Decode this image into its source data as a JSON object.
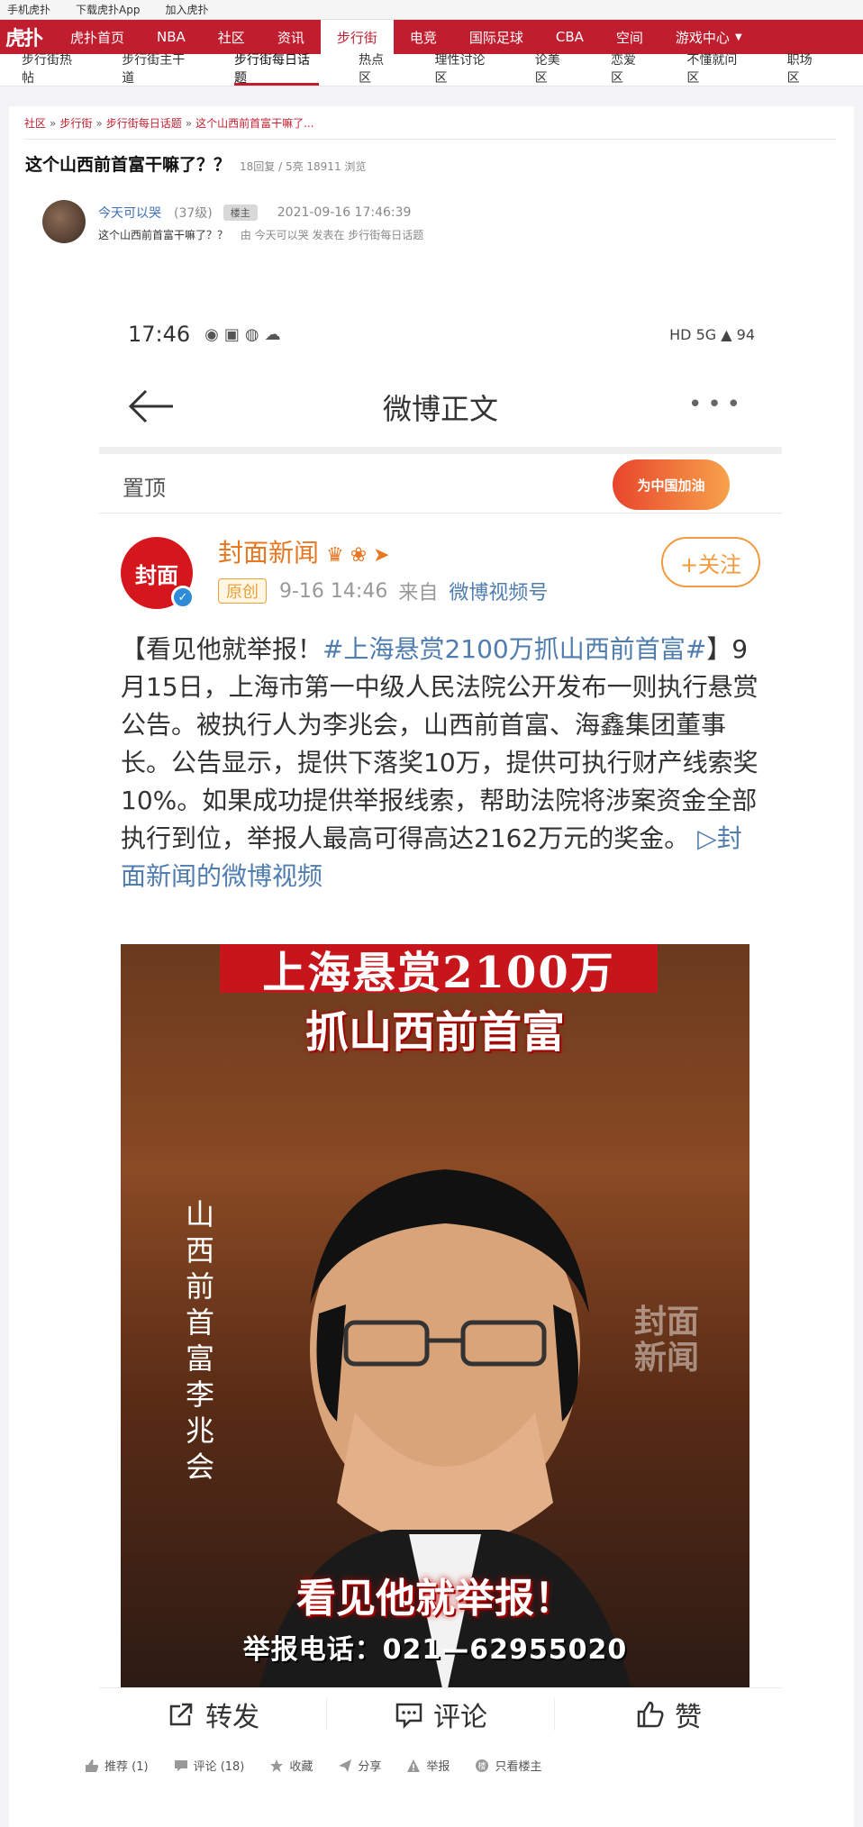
{
  "util_bar": {
    "items": [
      "手机虎扑",
      "下载虎扑App",
      "加入虎扑"
    ]
  },
  "brand": {
    "logo_text": "虎扑",
    "color": "#c01e2f"
  },
  "main_nav": {
    "items": [
      {
        "label": "虎扑首页"
      },
      {
        "label": "NBA"
      },
      {
        "label": "社区"
      },
      {
        "label": "资讯"
      },
      {
        "label": "步行街",
        "active": true
      },
      {
        "label": "电竞"
      },
      {
        "label": "国际足球"
      },
      {
        "label": "CBA"
      },
      {
        "label": "空间"
      },
      {
        "label": "游戏中心",
        "dropdown": true
      }
    ]
  },
  "sub_nav": {
    "items": [
      {
        "label": "步行街热帖"
      },
      {
        "label": "步行街主干道"
      },
      {
        "label": "步行街每日话题",
        "active": true
      },
      {
        "label": "热点区"
      },
      {
        "label": "理性讨论区"
      },
      {
        "label": "论美区"
      },
      {
        "label": "恋爱区"
      },
      {
        "label": "不懂就问区"
      },
      {
        "label": "职场区"
      }
    ]
  },
  "breadcrumb": [
    "社区",
    "步行街",
    "步行街每日话题",
    "这个山西前首富干嘛了..."
  ],
  "thread": {
    "title": "这个山西前首富干嘛了？？",
    "stats": "18回复 / 5亮 18911 浏览"
  },
  "post": {
    "author": "今天可以哭",
    "level": "(37级)",
    "op_badge": "楼主",
    "time": "2021-09-16 17:46:39",
    "text": "这个山西前首富干嘛了？？",
    "meta": "由  今天可以哭 发表在  步行街每日话题"
  },
  "screenshot": {
    "status_time": "17:46",
    "status_right": "HD 5G ▲ 94",
    "page_title": "微博正文",
    "pinned_label": "置顶",
    "pinned_badge": "为中国加油",
    "account_name": "封面新闻",
    "account_avatar_text": "封面",
    "original_badge": "原创",
    "post_time": "9-16 14:46",
    "source_prefix": "来自",
    "source": "微博视频号",
    "follow_label": "+关注",
    "text_intro": "【看见他就举报！",
    "text_hashtag": "#上海悬赏2100万抓山西前首富#",
    "text_body": "】9月15日，上海市第一中级人民法院公开发布一则执行悬赏公告。被执行人为李兆会，山西前首富、海鑫集团董事长。公告显示，提供下落奖10万，提供可执行财产线索奖10%。如果成功提供举报线索，帮助法院将涉案资金全部执行到位，举报人最高可得高达2162万元的奖金。",
    "text_link": "封面新闻的微博视频",
    "video": {
      "banner": "上海悬赏2100万",
      "subtitle": "抓山西前首富",
      "vertical_caption": "山西前首富李兆会",
      "watermark": "封面新闻",
      "caption": "看见他就举报！",
      "phone": "举报电话：021—62955020"
    },
    "actions": {
      "repost": "转发",
      "comment": "评论",
      "like": "赞"
    }
  },
  "forum_actions": [
    {
      "label": "推荐 (1)",
      "icon": "thumb-icon"
    },
    {
      "label": "评论 (18)",
      "icon": "comment-icon"
    },
    {
      "label": "收藏",
      "icon": "star-icon"
    },
    {
      "label": "分享",
      "icon": "share-icon"
    },
    {
      "label": "举报",
      "icon": "warning-icon"
    },
    {
      "label": "只看楼主",
      "icon": "op-icon"
    }
  ]
}
